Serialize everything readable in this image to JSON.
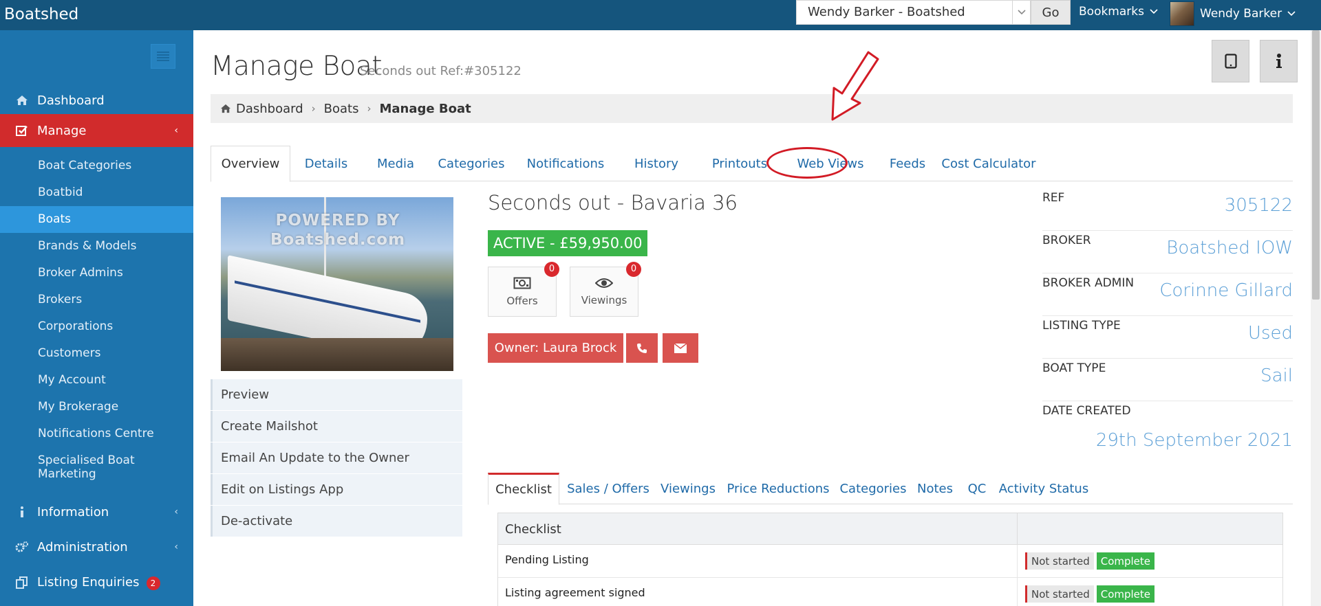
{
  "topbar": {
    "brand": "Boatshed",
    "account_select": "Wendy Barker - Boatshed",
    "go_label": "Go",
    "bookmarks_label": "Bookmarks",
    "user_name": "Wendy Barker"
  },
  "sidebar": {
    "dashboard": "Dashboard",
    "manage": "Manage",
    "sub_items": [
      "Boat Categories",
      "Boatbid",
      "Boats",
      "Brands & Models",
      "Broker Admins",
      "Brokers",
      "Corporations",
      "Customers",
      "My Account",
      "My Brokerage",
      "Notifications Centre",
      "Specialised Boat Marketing"
    ],
    "active_sub": "Boats",
    "information": "Information",
    "administration": "Administration",
    "listing_enquiries": "Listing Enquiries",
    "listing_enquiries_count": "2"
  },
  "header": {
    "title": "Manage Boat",
    "subtitle": "Seconds out Ref:#305122"
  },
  "breadcrumb": {
    "items": [
      "Dashboard",
      "Boats",
      "Manage Boat"
    ]
  },
  "tabs": [
    "Overview",
    "Details",
    "Media",
    "Categories",
    "Notifications",
    "History",
    "Printouts",
    "Web Views",
    "Feeds",
    "Cost Calculator"
  ],
  "boat_image": {
    "watermark_line1": "POWERED BY",
    "watermark_line2": "Boatshed.com"
  },
  "side_links": [
    "Preview",
    "Create Mailshot",
    "Email An Update to the Owner",
    "Edit on Listings App",
    "De-activate"
  ],
  "boat": {
    "name": "Seconds out - Bavaria 36",
    "status": "ACTIVE - £59,950.00",
    "offers_label": "Offers",
    "offers_count": "0",
    "viewings_label": "Viewings",
    "viewings_count": "0",
    "owner_label": "Owner: Laura Brock"
  },
  "info": [
    {
      "key": "REF",
      "value": "305122"
    },
    {
      "key": "BROKER",
      "value": "Boatshed IOW"
    },
    {
      "key": "BROKER ADMIN",
      "value": "Corinne Gillard"
    },
    {
      "key": "LISTING TYPE",
      "value": "Used"
    },
    {
      "key": "BOAT TYPE",
      "value": "Sail"
    },
    {
      "key": "DATE CREATED",
      "value": "29th September 2021"
    }
  ],
  "subtabs": [
    "Checklist",
    "Sales / Offers",
    "Viewings",
    "Price Reductions",
    "Categories",
    "Notes",
    "QC",
    "Activity Status"
  ],
  "checklist": {
    "header": "Checklist",
    "rows": [
      {
        "label": "Pending Listing",
        "status_a": "Not started",
        "status_b": "Complete"
      },
      {
        "label": "Listing agreement signed",
        "status_a": "Not started",
        "status_b": "Complete"
      }
    ]
  },
  "colors": {
    "topbar": "#15557d",
    "sidebar": "#1d74ad",
    "manage_active": "#d12b2c",
    "sub_active": "#2d96dc",
    "status_green": "#3ab54a",
    "owner_red": "#d9534f",
    "annotation_red": "#d21b25"
  },
  "icons": {
    "dashboard": "home-icon",
    "manage": "check-square-icon",
    "information": "info-icon",
    "administration": "gears-icon",
    "listing_enquiries": "copy-icon",
    "offers": "money-icon",
    "viewings": "eye-icon",
    "phone": "phone-icon",
    "email": "envelope-icon",
    "tablet": "tablet-icon",
    "info_header": "info-icon"
  }
}
